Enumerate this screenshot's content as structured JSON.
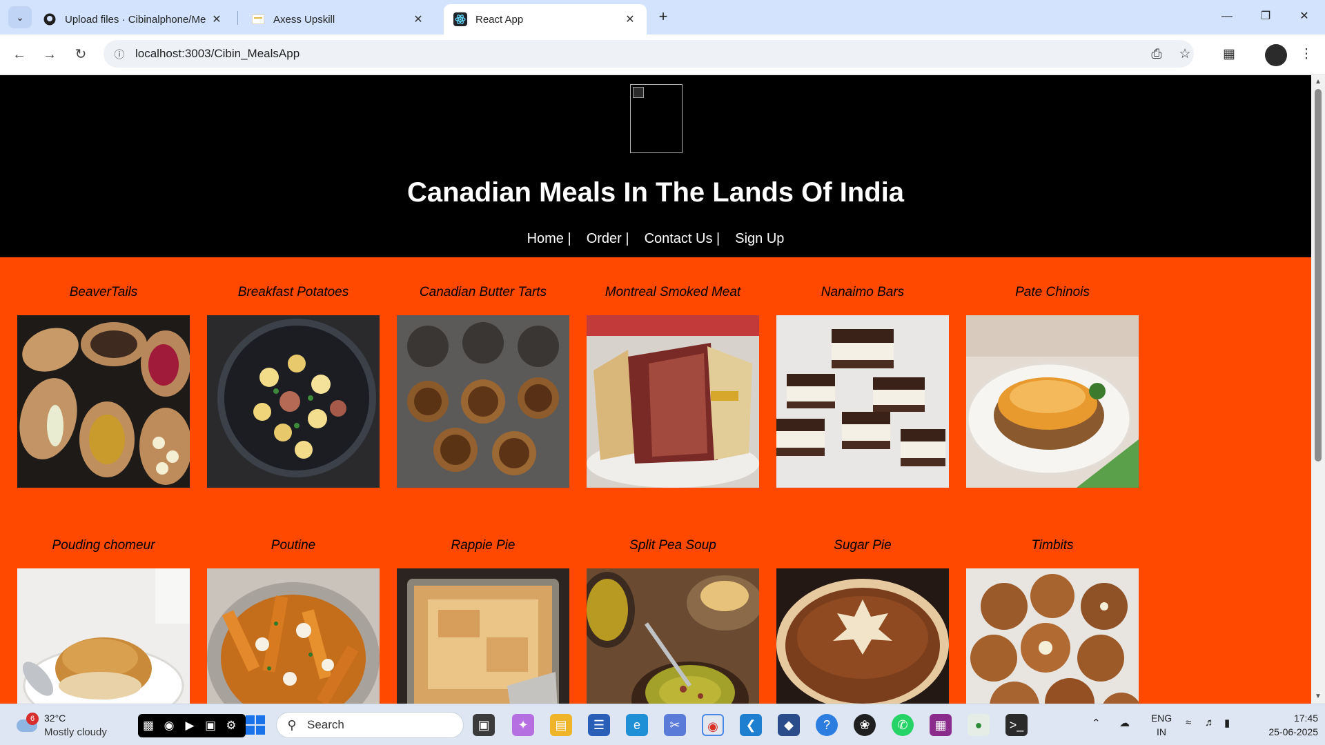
{
  "browser": {
    "tabs": [
      {
        "title": "Upload files · Cibinalphone/Me",
        "active": false
      },
      {
        "title": "Axess Upskill",
        "active": false
      },
      {
        "title": "React App",
        "active": true
      }
    ],
    "url": "localhost:3003/Cibin_MealsApp",
    "icons": [
      "back-arrow-icon",
      "forward-arrow-icon",
      "reload-icon",
      "site-info-icon",
      "install-app-icon",
      "bookmark-star-icon",
      "extensions-icon",
      "more-menu-icon"
    ]
  },
  "site": {
    "title": "Canadian Meals In The Lands Of India",
    "nav": [
      "Home |",
      "Order |",
      "Contact Us |",
      "Sign Up"
    ],
    "meals": [
      {
        "name": "BeaverTails"
      },
      {
        "name": "Breakfast Potatoes"
      },
      {
        "name": "Canadian Butter Tarts"
      },
      {
        "name": "Montreal Smoked Meat"
      },
      {
        "name": "Nanaimo Bars"
      },
      {
        "name": "Pate Chinois"
      },
      {
        "name": "Pouding chomeur"
      },
      {
        "name": "Poutine"
      },
      {
        "name": "Rappie Pie"
      },
      {
        "name": "Split Pea Soup"
      },
      {
        "name": "Sugar Pie"
      },
      {
        "name": "Timbits"
      }
    ],
    "colors": {
      "header_bg": "#000000",
      "body_bg": "#ff4800",
      "text": "#ffffff"
    }
  },
  "taskbar": {
    "weather": {
      "temp": "32°C",
      "condition": "Mostly cloudy",
      "badge": "6"
    },
    "search_label": "Search",
    "language": [
      "ENG",
      "IN"
    ],
    "time": "17:45",
    "date": "25-06-2025"
  }
}
